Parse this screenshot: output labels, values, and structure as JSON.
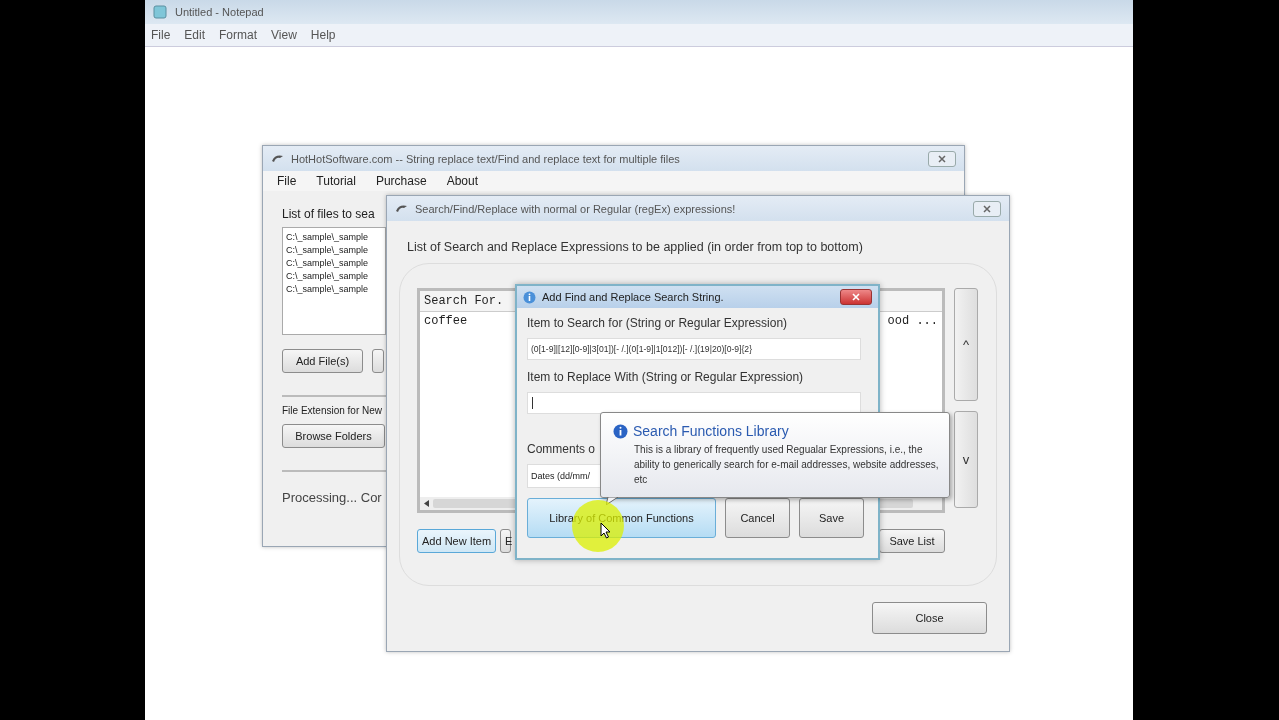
{
  "notepad": {
    "title": "Untitled - Notepad",
    "menu": [
      "File",
      "Edit",
      "Format",
      "View",
      "Help"
    ]
  },
  "main_window": {
    "title": "HotHotSoftware.com -- String replace text/Find and replace text for multiple files",
    "menu": [
      "File",
      "Tutorial",
      "Purchase",
      "About"
    ],
    "files_label": "List of files to sea",
    "files": [
      "C:\\_sample\\_sample",
      "C:\\_sample\\_sample",
      "C:\\_sample\\_sample",
      "C:\\_sample\\_sample",
      "C:\\_sample\\_sample"
    ],
    "add_files_button": "Add File(s)",
    "extension_label": "File Extension for New",
    "browse_button": "Browse Folders",
    "status": "Processing... Cor"
  },
  "expressions_window": {
    "title": "Search/Find/Replace with normal or Regular (regEx) expressions!",
    "list_label": "List of Search and Replace Expressions to be applied (in order from top to bottom)",
    "column_1": "Search For.",
    "rows": [
      {
        "search": "coffee",
        "column_2": "ood ..."
      }
    ],
    "up_button": "^",
    "down_button": "v",
    "add_button": "Add New Item",
    "partial_button": "E",
    "save_list_button": "Save List",
    "close_button": "Close"
  },
  "add_dialog": {
    "title": "Add Find and Replace Search String.",
    "search_label": "Item to Search for (String or Regular Expression)",
    "search_value": "(0[1-9]|[12][0-9]|3[01])[- /.](0[1-9]|1[012])[- /.](19|20)[0-9]{2}",
    "replace_label": "Item to Replace With (String or Regular Expression)",
    "comments_label": "Comments o",
    "comments_value": "Dates (dd/mm/",
    "library_button": "Library of Common Functions",
    "cancel_button": "Cancel",
    "save_button": "Save"
  },
  "tooltip": {
    "title": "Search Functions Library",
    "text": "This is a library of frequently used Regualar Expressions, i.e., the ability to generically search for e-mail addresses, website addresses, etc"
  }
}
